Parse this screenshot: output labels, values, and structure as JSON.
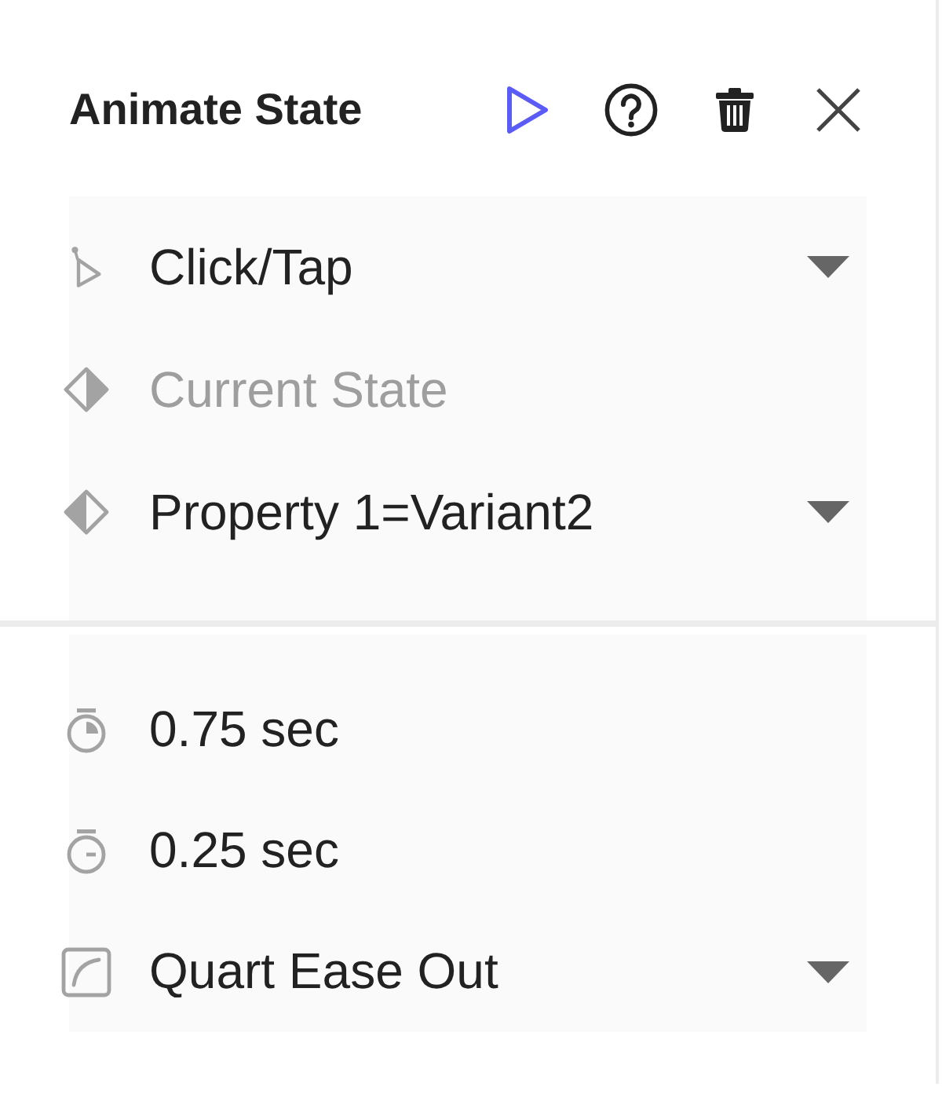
{
  "header": {
    "title": "Animate State"
  },
  "sections": [
    {
      "rows": [
        {
          "kind": "trigger",
          "value": "Click/Tap",
          "dropdown": true,
          "disabled": false
        },
        {
          "kind": "from_state",
          "value": "Current State",
          "dropdown": false,
          "disabled": true
        },
        {
          "kind": "to_state",
          "value": "Property 1=Variant2",
          "dropdown": true,
          "disabled": false
        }
      ]
    },
    {
      "rows": [
        {
          "kind": "duration",
          "value": "0.75 sec",
          "dropdown": false,
          "disabled": false
        },
        {
          "kind": "delay",
          "value": "0.25 sec",
          "dropdown": false,
          "disabled": false
        },
        {
          "kind": "easing",
          "value": "Quart Ease Out",
          "dropdown": true,
          "disabled": false
        }
      ]
    }
  ]
}
